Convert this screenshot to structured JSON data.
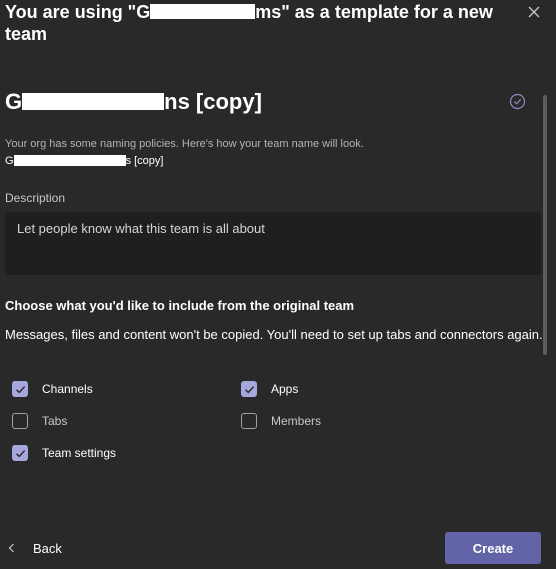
{
  "dialog": {
    "title_prefix": "You are using \"G",
    "title_suffix": "ms\" as a template for a new team",
    "team_name_prefix": "G",
    "team_name_suffix": "ns [copy]",
    "naming_policy_text": "Your org has some naming policies. Here's how your team name will look.",
    "policy_preview_prefix": "G",
    "policy_preview_suffix": "s [copy]"
  },
  "description": {
    "label": "Description",
    "placeholder": "Let people know what this team is all about"
  },
  "include": {
    "title": "Choose what you'd like to include from the original team",
    "note": "Messages, files and content won't be copied. You'll need to set up tabs and connectors again.",
    "options": [
      {
        "label": "Channels",
        "checked": true
      },
      {
        "label": "Apps",
        "checked": true
      },
      {
        "label": "Tabs",
        "checked": false
      },
      {
        "label": "Members",
        "checked": false
      },
      {
        "label": "Team settings",
        "checked": true
      }
    ]
  },
  "footer": {
    "back_label": "Back",
    "create_label": "Create"
  },
  "colors": {
    "accent": "#6264a7",
    "checkbox_fill": "#a6a7dc",
    "background": "#292929"
  }
}
